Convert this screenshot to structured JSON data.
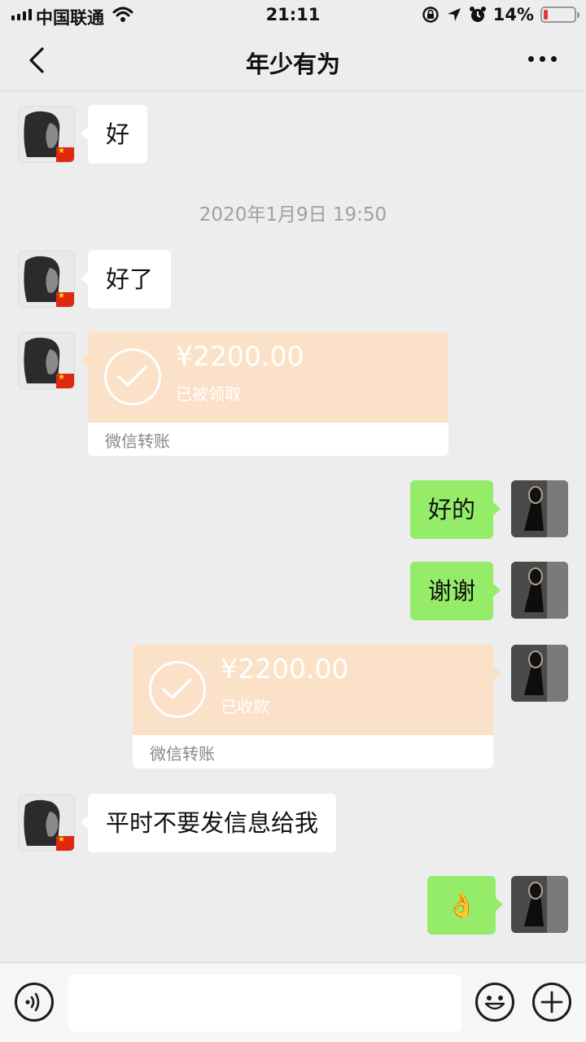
{
  "status_bar": {
    "carrier": "中国联通",
    "time": "21:11",
    "battery_percent": "14%",
    "battery_level": 0.14
  },
  "nav": {
    "title": "年少有为"
  },
  "messages": {
    "m1": "好",
    "timestamp": "2020年1月9日 19:50",
    "m2": "好了",
    "transfer1": {
      "amount": "¥2200.00",
      "status": "已被领取",
      "label": "微信转账"
    },
    "m3": "好的",
    "m4": "谢谢",
    "transfer2": {
      "amount": "¥2200.00",
      "status": "已收款",
      "label": "微信转账"
    },
    "m5": "平时不要发信息给我",
    "m6": "👌"
  },
  "input_bar": {
    "text_value": ""
  },
  "colors": {
    "background": "#ededed",
    "sent_bubble": "#95ec69",
    "received_bubble": "#ffffff",
    "transfer_card": "#fbe1c7"
  }
}
